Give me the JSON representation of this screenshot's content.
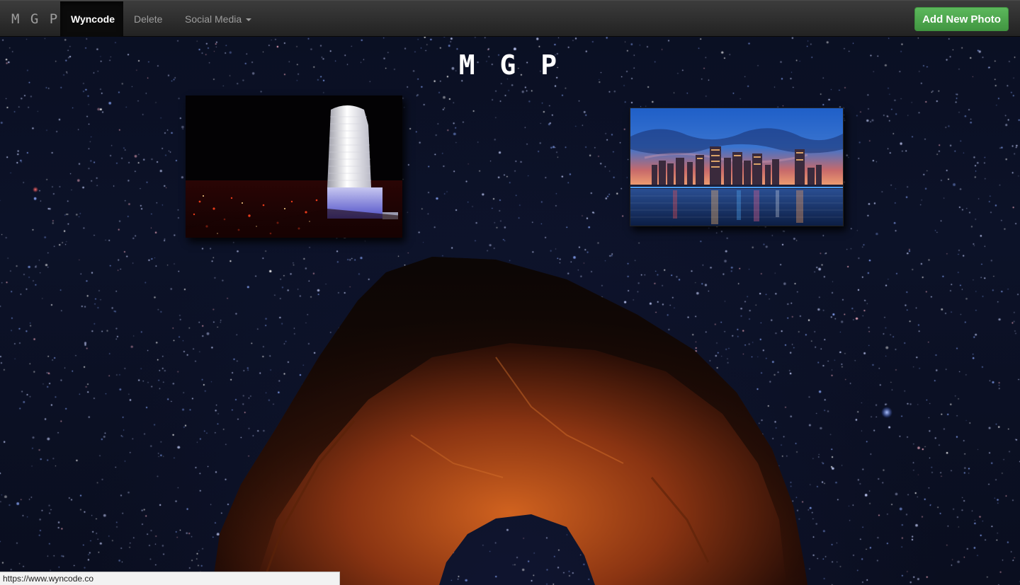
{
  "navbar": {
    "brand": "M G P",
    "items": [
      {
        "label": "Wyncode",
        "active": true
      },
      {
        "label": "Delete",
        "active": false
      },
      {
        "label": "Social Media",
        "active": false,
        "dropdown": true
      }
    ],
    "add_button_label": "Add New Photo"
  },
  "main": {
    "title": "M G P",
    "photos": [
      {
        "subject": "night-skyscraper"
      },
      {
        "subject": "city-skyline-at-dusk"
      }
    ],
    "background": "starry-night-sky-with-rock-arch"
  },
  "status_bar": {
    "url": "https://www.wyncode.co"
  },
  "colors": {
    "navbar": "#222222",
    "active_nav": "#0b0b0b",
    "success": "#5cb85c",
    "sky": "#0a0f22",
    "rock": "#b04a1c"
  }
}
